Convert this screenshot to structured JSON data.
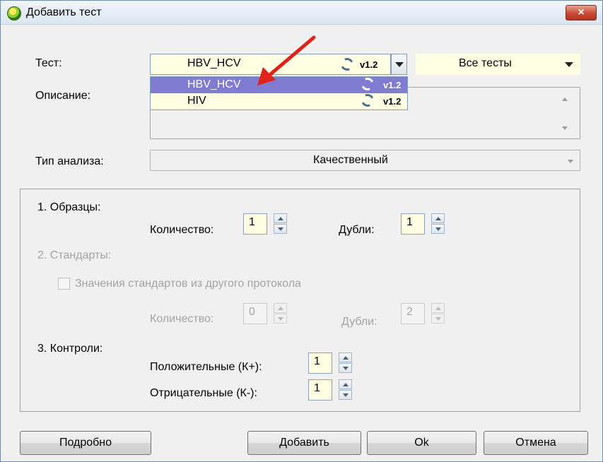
{
  "window": {
    "title": "Добавить тест",
    "close_symbol": "×"
  },
  "test": {
    "label": "Тест:",
    "selected": "HBV_HCV",
    "version": "v1.2",
    "filter": "Все тесты",
    "options": [
      {
        "name": "HBV_HCV",
        "version": "v1.2"
      },
      {
        "name": "HIV",
        "version": "v1.2"
      }
    ]
  },
  "description": {
    "label": "Описание:"
  },
  "analysis": {
    "label": "Тип анализа:",
    "value": "Качественный"
  },
  "samples": {
    "header": "1. Образцы:",
    "count_label": "Количество:",
    "count": "1",
    "dup_label": "Дубли:",
    "dup": "1"
  },
  "standards": {
    "header": "2. Стандарты:",
    "checkbox_label": "Значения стандартов из другого протокола",
    "count_label": "Количество:",
    "count": "0",
    "dup_label": "Дубли:",
    "dup": "2"
  },
  "controls": {
    "header": "3. Контроли:",
    "positive_label": "Положительные (К+):",
    "positive": "1",
    "negative_label": "Отрицательные (К-):",
    "negative": "1"
  },
  "buttons": {
    "details": "Подробно",
    "add": "Добавить",
    "ok": "Ok",
    "cancel": "Отмена"
  },
  "colors": {
    "selection": "#7e7bd0",
    "input_bg": "#fefee3",
    "arrow": "#e0221b",
    "close": "#c84a34"
  }
}
